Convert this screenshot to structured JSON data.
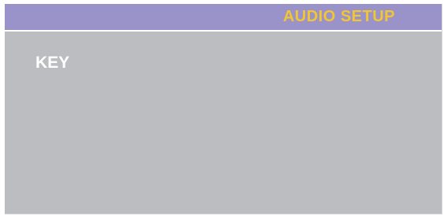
{
  "header": {
    "title": "AUDIO SETUP"
  },
  "menu": {
    "items": [
      {
        "label": "KEY"
      }
    ]
  },
  "colors": {
    "header_bg": "#9a93c9",
    "title_text": "#f2c531",
    "panel_bg": "#bcbdc1",
    "item_text": "#ffffff"
  }
}
